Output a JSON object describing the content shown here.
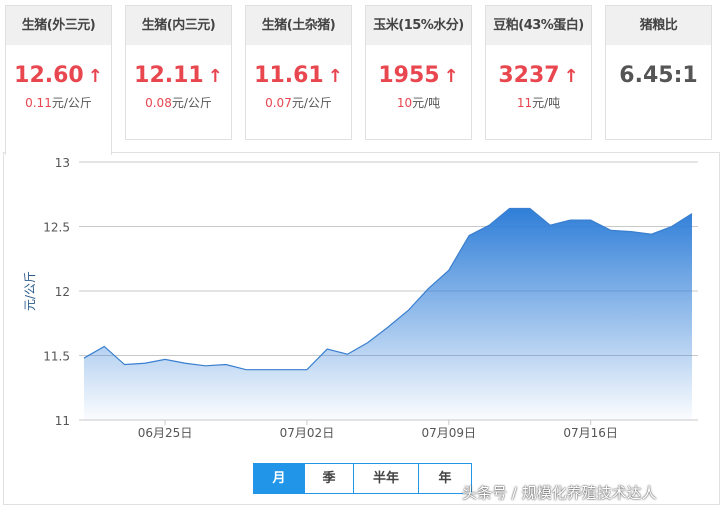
{
  "cards": [
    {
      "title": "生猪(外三元)",
      "value": "12.60",
      "change": "0.11",
      "unit": "元/公斤"
    },
    {
      "title": "生猪(内三元)",
      "value": "12.11",
      "change": "0.08",
      "unit": "元/公斤"
    },
    {
      "title": "生猪(土杂猪)",
      "value": "11.61",
      "change": "0.07",
      "unit": "元/公斤"
    },
    {
      "title": "玉米(15%水分)",
      "value": "1955",
      "change": "10",
      "unit": "元/吨"
    },
    {
      "title": "豆粕(43%蛋白)",
      "value": "3237",
      "change": "11",
      "unit": "元/吨"
    },
    {
      "title": "猪粮比",
      "value": "6.45:1"
    }
  ],
  "arrow": "↑",
  "range_buttons": [
    "月",
    "季",
    "半年",
    "年"
  ],
  "watermark": "头条号 / 规模化养殖技术达人",
  "chart_data": {
    "type": "area",
    "title": "",
    "xlabel": "",
    "ylabel": "元/公斤",
    "ylim": [
      11,
      13
    ],
    "yticks": [
      "11",
      "11.5",
      "12",
      "12.5",
      "13"
    ],
    "xtick_labels": [
      {
        "index": 4,
        "label": "06月25日"
      },
      {
        "index": 11,
        "label": "07月02日"
      },
      {
        "index": 18,
        "label": "07月09日"
      },
      {
        "index": 25,
        "label": "07月16日"
      }
    ],
    "grid": true,
    "color": "#2f7ed8",
    "values": [
      11.48,
      11.57,
      11.43,
      11.44,
      11.47,
      11.44,
      11.42,
      11.43,
      11.39,
      11.39,
      11.39,
      11.39,
      11.55,
      11.51,
      11.6,
      11.72,
      11.85,
      12.02,
      12.16,
      12.43,
      12.51,
      12.64,
      12.64,
      12.51,
      12.55,
      12.55,
      12.47,
      12.46,
      12.44,
      12.5,
      12.6
    ]
  }
}
